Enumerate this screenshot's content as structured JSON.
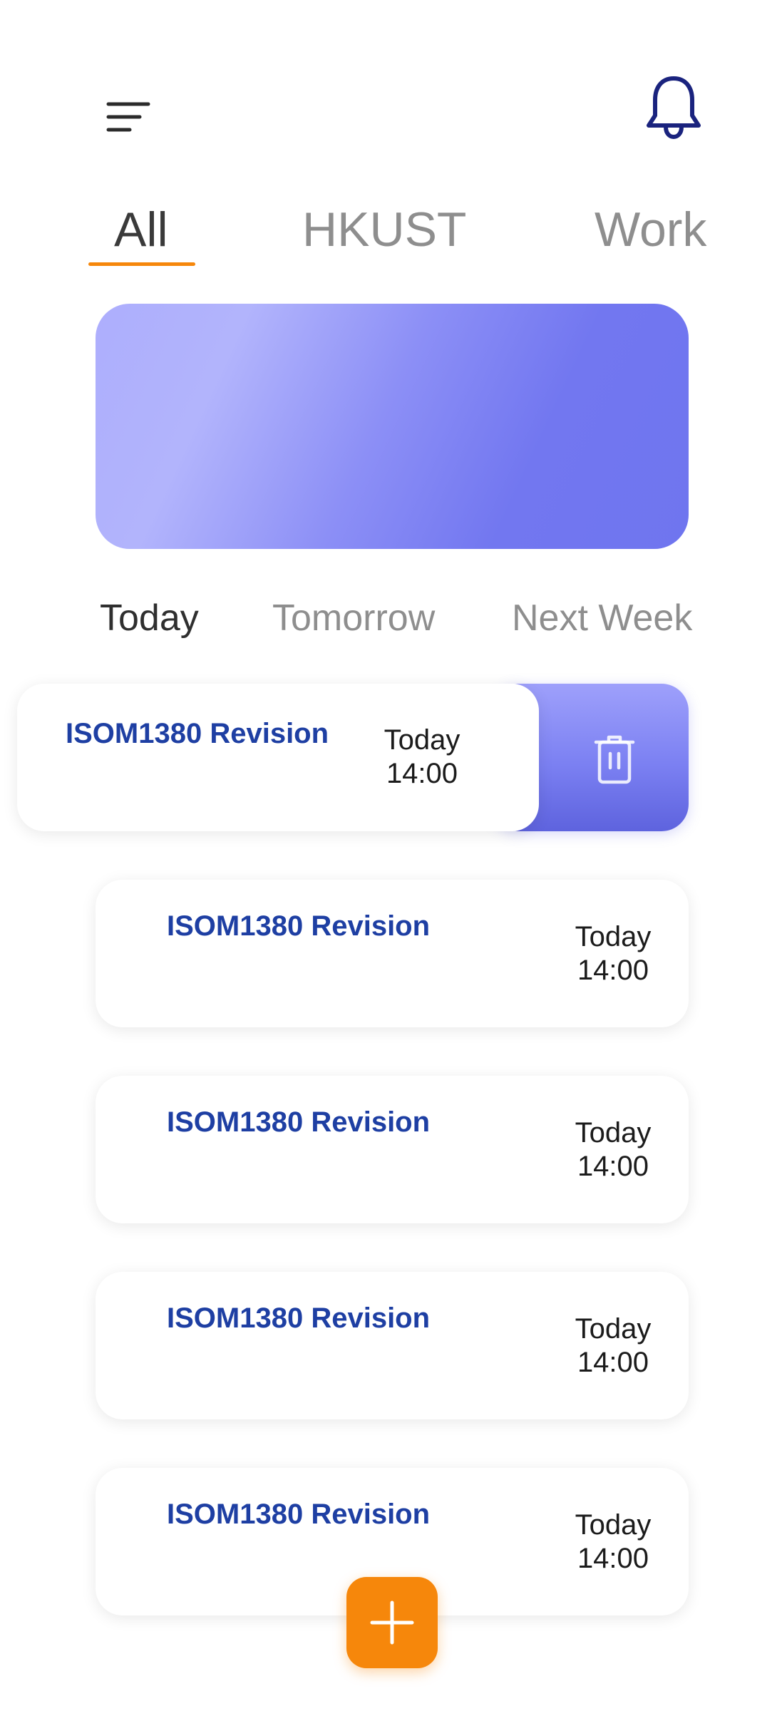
{
  "header": {
    "menu_icon": "sort-lines-icon",
    "notification_icon": "bell-icon"
  },
  "categories": [
    {
      "label": "All",
      "active": true
    },
    {
      "label": "HKUST",
      "active": false
    },
    {
      "label": "Work",
      "active": false
    }
  ],
  "day_tabs": [
    {
      "label": "Today",
      "active": true
    },
    {
      "label": "Tomorrow",
      "active": false
    },
    {
      "label": "Next Week",
      "active": false
    }
  ],
  "tasks": [
    {
      "title": "ISOM1380 Revision",
      "day": "Today",
      "time": "14:00",
      "swiped": true
    },
    {
      "title": "ISOM1380 Revision",
      "day": "Today",
      "time": "14:00",
      "swiped": false
    },
    {
      "title": "ISOM1380 Revision",
      "day": "Today",
      "time": "14:00",
      "swiped": false
    },
    {
      "title": "ISOM1380 Revision",
      "day": "Today",
      "time": "14:00",
      "swiped": false
    },
    {
      "title": "ISOM1380 Revision",
      "day": "Today",
      "time": "14:00",
      "swiped": false
    }
  ],
  "actions": {
    "delete_icon": "trash-icon",
    "add_icon": "plus-icon"
  },
  "colors": {
    "accent": "#f6870b",
    "task_title": "#1e3fa3",
    "bell": "#1a237e",
    "banner_start": "#adaefd",
    "banner_end": "#6f75ef"
  }
}
